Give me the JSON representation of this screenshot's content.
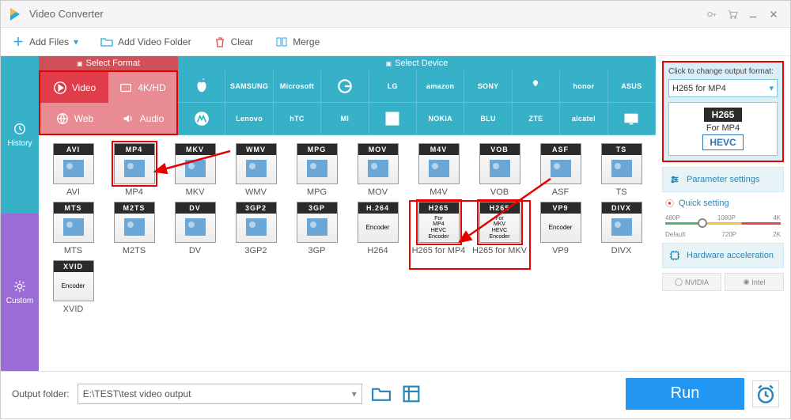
{
  "window": {
    "title": "Video Converter"
  },
  "toolbar": {
    "add_files": "Add Files",
    "add_folder": "Add Video Folder",
    "clear": "Clear",
    "merge": "Merge"
  },
  "sidebar": {
    "history": "History",
    "custom": "Custom"
  },
  "headers": {
    "format": "Select Format",
    "device": "Select Device"
  },
  "categories": {
    "video": "Video",
    "fourk": "4K/HD",
    "web": "Web",
    "audio": "Audio"
  },
  "devices": {
    "row1": [
      "apple",
      "SAMSUNG",
      "Microsoft",
      "G",
      "LG",
      "amazon",
      "SONY",
      "HUAWEI",
      "honor",
      "ASUS"
    ],
    "row2": [
      "moto",
      "Lenovo",
      "hTC",
      "MI",
      "oneplus",
      "NOKIA",
      "BLU",
      "ZTE",
      "alcatel",
      "TV"
    ]
  },
  "formats": [
    {
      "id": "AVI",
      "label": "AVI"
    },
    {
      "id": "MP4",
      "label": "MP4",
      "hl": true
    },
    {
      "id": "MKV",
      "label": "MKV"
    },
    {
      "id": "WMV",
      "label": "WMV"
    },
    {
      "id": "MPG",
      "label": "MPG"
    },
    {
      "id": "MOV",
      "label": "MOV"
    },
    {
      "id": "M4V",
      "label": "M4V"
    },
    {
      "id": "VOB",
      "label": "VOB"
    },
    {
      "id": "ASF",
      "label": "ASF"
    },
    {
      "id": "TS",
      "label": "TS"
    },
    {
      "id": "MTS",
      "label": "MTS"
    },
    {
      "id": "M2TS",
      "label": "M2TS"
    },
    {
      "id": "DV",
      "label": "DV"
    },
    {
      "id": "3GP2",
      "label": "3GP2"
    },
    {
      "id": "3GP",
      "label": "3GP"
    },
    {
      "id": "H.264",
      "label": "H264",
      "sub": "Encoder"
    },
    {
      "id": "H265",
      "label": "H265 for MP4",
      "sub": "For MP4 HEVC Encoder",
      "hl": true
    },
    {
      "id": "H265",
      "label": "H265 for MKV",
      "sub": "For MKV HEVC Encoder",
      "hl": true
    },
    {
      "id": "VP9",
      "label": "VP9",
      "sub": "Encoder"
    },
    {
      "id": "DIVX",
      "label": "DIVX"
    },
    {
      "id": "XVID",
      "label": "XVID",
      "sub": "Encoder"
    }
  ],
  "output_panel": {
    "header": "Click to change output format:",
    "selected": "H265 for MP4",
    "tag_top": "H265",
    "tag_mid": "For MP4",
    "tag_box": "HEVC"
  },
  "right": {
    "param": "Parameter settings",
    "quick": "Quick setting",
    "ticks_top": [
      "480P",
      "1080P",
      "4K"
    ],
    "ticks_bot": [
      "Default",
      "720P",
      "2K"
    ],
    "hw": "Hardware acceleration",
    "nvidia": "NVIDIA",
    "intel": "Intel"
  },
  "bottom": {
    "label": "Output folder:",
    "path": "E:\\TEST\\test video output",
    "run": "Run"
  }
}
